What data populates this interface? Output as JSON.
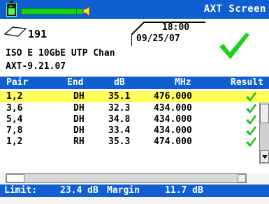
{
  "header": {
    "title": "AXT Screen",
    "count": "191",
    "time": "18:00",
    "date": "09/25/07",
    "test_name": "ISO E 10GbE UTP Chan",
    "version": "AXT-9.21.07",
    "status": "pass"
  },
  "table": {
    "columns": [
      "Pair",
      "End",
      "dB",
      "MHz",
      "Result"
    ],
    "rows": [
      {
        "pair": "1,2",
        "end": "DH",
        "db": "35.1",
        "mhz": "476.000",
        "result": "pass",
        "selected": true
      },
      {
        "pair": "3,6",
        "end": "DH",
        "db": "32.3",
        "mhz": "434.000",
        "result": "pass"
      },
      {
        "pair": "5,4",
        "end": "DH",
        "db": "34.8",
        "mhz": "434.000",
        "result": "pass"
      },
      {
        "pair": "7,8",
        "end": "DH",
        "db": "33.4",
        "mhz": "434.000",
        "result": "pass"
      },
      {
        "pair": "1,2",
        "end": "RH",
        "db": "35.3",
        "mhz": "474.000",
        "result": "pass"
      }
    ]
  },
  "footer": {
    "limit_label": "Limit:",
    "limit_value": "23.4 dB",
    "margin_label": "Margin",
    "margin_value": "11.7 dB"
  },
  "colors": {
    "header_blue": "#0f5fd2",
    "selected_row": "#ffff55",
    "pass_green": "#1fbf1f",
    "battery_green": "#4cff4c"
  },
  "icons": [
    "battery-icon",
    "level-bar",
    "speaker-icon",
    "check-icon"
  ]
}
